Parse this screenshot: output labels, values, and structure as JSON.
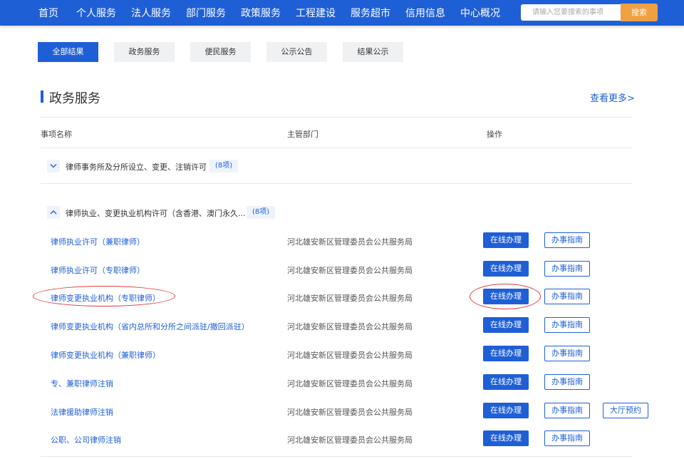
{
  "nav": {
    "items": [
      "首页",
      "个人服务",
      "法人服务",
      "部门服务",
      "政策服务",
      "工程建设",
      "服务超市",
      "信用信息",
      "中心概况"
    ],
    "search_placeholder": "请输入您要搜索的事项",
    "search_button": "搜索"
  },
  "tabs": [
    {
      "label": "全部结果",
      "active": true
    },
    {
      "label": "政务服务",
      "active": false
    },
    {
      "label": "便民服务",
      "active": false
    },
    {
      "label": "公示公告",
      "active": false
    },
    {
      "label": "结果公示",
      "active": false
    }
  ],
  "section": {
    "title": "政务服务",
    "more": "查看更多>"
  },
  "columns": {
    "name": "事项名称",
    "dept": "主管部门",
    "ops": "操作"
  },
  "groups": [
    {
      "title": "律师事务所及分所设立、变更、注销许可",
      "count": "(8项)",
      "expanded": false
    },
    {
      "title": "律师执业、变更执业机构许可（含香港、澳门永久...",
      "count": "(8项)",
      "expanded": true
    }
  ],
  "items": [
    {
      "name": "律师执业许可（兼职律师）",
      "dept": "河北雄安新区管理委员会公共服务局",
      "online": "在线办理",
      "guide": "办事指南"
    },
    {
      "name": "律师执业许可（专职律师）",
      "dept": "河北雄安新区管理委员会公共服务局",
      "online": "在线办理",
      "guide": "办事指南"
    },
    {
      "name": "律师变更执业机构（专职律师）",
      "dept": "河北雄安新区管理委员会公共服务局",
      "online": "在线办理",
      "guide": "办事指南"
    },
    {
      "name": "律师变更执业机构（省内总所和分所之间派驻/撤回派驻）",
      "dept": "河北雄安新区管理委员会公共服务局",
      "online": "在线办理",
      "guide": "办事指南"
    },
    {
      "name": "律师变更执业机构（兼职律师）",
      "dept": "河北雄安新区管理委员会公共服务局",
      "online": "在线办理",
      "guide": "办事指南"
    },
    {
      "name": "专、兼职律师注销",
      "dept": "河北雄安新区管理委员会公共服务局",
      "online": "在线办理",
      "guide": "办事指南"
    },
    {
      "name": "法律援助律师注销",
      "dept": "河北雄安新区管理委员会公共服务局",
      "online": "在线办理",
      "guide": "办事指南",
      "appointment": "大厅预约"
    },
    {
      "name": "公职、公司律师注销",
      "dept": "河北雄安新区管理委员会公共服务局",
      "online": "在线办理",
      "guide": "办事指南"
    }
  ],
  "colors": {
    "primary": "#1f5fd6",
    "search_button": "#f0a040",
    "highlight_oval": "#e03a3a"
  }
}
